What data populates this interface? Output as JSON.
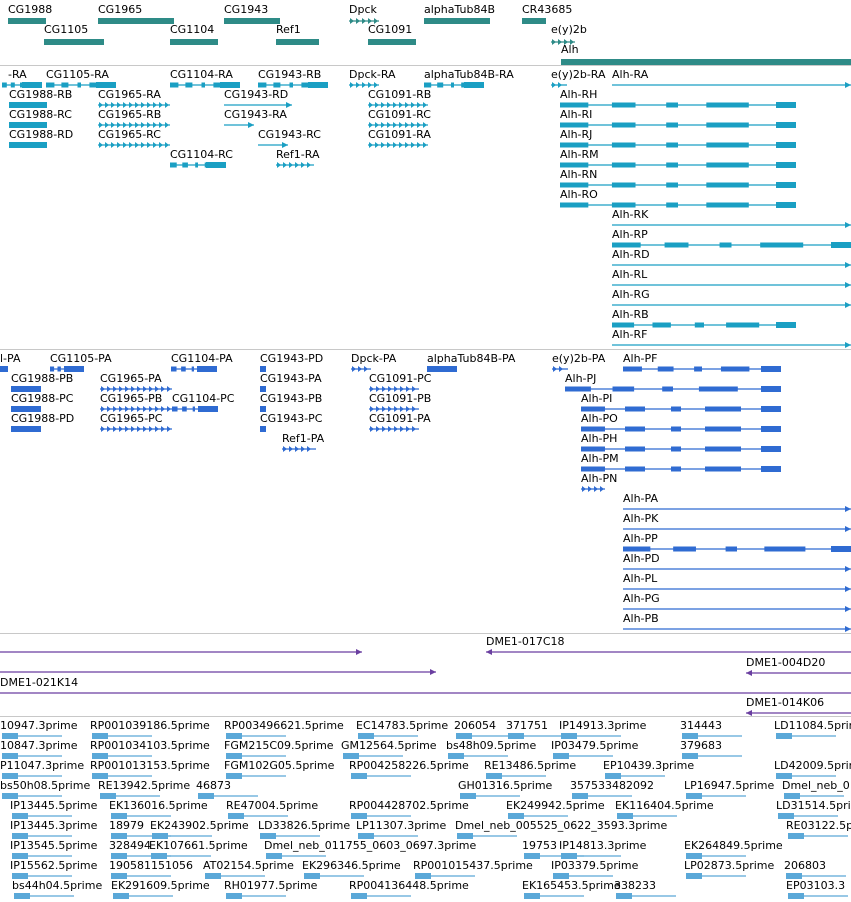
{
  "colors": {
    "gene": "#2e8b87",
    "transcript_rna": "#1a9fc3",
    "transcript_protein": "#2f6bd2",
    "clone": "#6a3fa0",
    "est": "#5aa8d8",
    "divider": "#c8c8c8"
  },
  "genes": [
    {
      "label": "CG1988"
    },
    {
      "label": "CG1965"
    },
    {
      "label": "CG1943"
    },
    {
      "label": "Dpck"
    },
    {
      "label": "alphaTub84B"
    },
    {
      "label": "CR43685"
    },
    {
      "label": "CG1105"
    },
    {
      "label": "CG1104"
    },
    {
      "label": "Ref1"
    },
    {
      "label": "CG1091"
    },
    {
      "label": "e(y)2b"
    },
    {
      "label": "Alh"
    }
  ],
  "rna": [
    {
      "label": "-RA"
    },
    {
      "label": "CG1105-RA"
    },
    {
      "label": "CG1104-RA"
    },
    {
      "label": "CG1943-RB"
    },
    {
      "label": "Dpck-RA"
    },
    {
      "label": "alphaTub84B-RA"
    },
    {
      "label": "e(y)2b-RA"
    },
    {
      "label": "Alh-RA"
    },
    {
      "label": "CG1988-RB"
    },
    {
      "label": "CG1965-RA"
    },
    {
      "label": "CG1943-RD"
    },
    {
      "label": "CG1091-RB"
    },
    {
      "label": "Alh-RH"
    },
    {
      "label": "CG1988-RC"
    },
    {
      "label": "CG1965-RB"
    },
    {
      "label": "CG1943-RA"
    },
    {
      "label": "CG1091-RC"
    },
    {
      "label": "Alh-RI"
    },
    {
      "label": "CG1988-RD"
    },
    {
      "label": "CG1965-RC"
    },
    {
      "label": "CG1943-RC"
    },
    {
      "label": "CG1091-RA"
    },
    {
      "label": "Alh-RJ"
    },
    {
      "label": "CG1104-RC"
    },
    {
      "label": "Ref1-RA"
    },
    {
      "label": "Alh-RM"
    },
    {
      "label": "Alh-RN"
    },
    {
      "label": "Alh-RO"
    },
    {
      "label": "Alh-RK"
    },
    {
      "label": "Alh-RP"
    },
    {
      "label": "Alh-RD"
    },
    {
      "label": "Alh-RL"
    },
    {
      "label": "Alh-RG"
    },
    {
      "label": "Alh-RB"
    },
    {
      "label": "Alh-RF"
    }
  ],
  "protein": [
    {
      "label": "l-PA"
    },
    {
      "label": "CG1105-PA"
    },
    {
      "label": "CG1104-PA"
    },
    {
      "label": "CG1943-PD"
    },
    {
      "label": "Dpck-PA"
    },
    {
      "label": "alphaTub84B-PA"
    },
    {
      "label": "e(y)2b-PA"
    },
    {
      "label": "Alh-PF"
    },
    {
      "label": "CG1988-PB"
    },
    {
      "label": "CG1965-PA"
    },
    {
      "label": "CG1943-PA"
    },
    {
      "label": "CG1091-PC"
    },
    {
      "label": "Alh-PJ"
    },
    {
      "label": "CG1988-PC"
    },
    {
      "label": "CG1965-PB"
    },
    {
      "label": "CG1104-PC"
    },
    {
      "label": "CG1943-PB"
    },
    {
      "label": "CG1091-PB"
    },
    {
      "label": "Alh-PI"
    },
    {
      "label": "CG1988-PD"
    },
    {
      "label": "CG1965-PC"
    },
    {
      "label": "CG1943-PC"
    },
    {
      "label": "CG1091-PA"
    },
    {
      "label": "Alh-PO"
    },
    {
      "label": "Ref1-PA"
    },
    {
      "label": "Alh-PH"
    },
    {
      "label": "Alh-PM"
    },
    {
      "label": "Alh-PN"
    },
    {
      "label": "Alh-PA"
    },
    {
      "label": "Alh-PK"
    },
    {
      "label": "Alh-PP"
    },
    {
      "label": "Alh-PD"
    },
    {
      "label": "Alh-PL"
    },
    {
      "label": "Alh-PG"
    },
    {
      "label": "Alh-PB"
    }
  ],
  "clones": [
    {
      "label": "DME1-017C18"
    },
    {
      "label": "DME1-004D20"
    },
    {
      "label": "DME1-021K14"
    },
    {
      "label": "DME1-014K06"
    }
  ],
  "ests": [
    {
      "label": "10947.3prime"
    },
    {
      "label": "RP001039186.5prime"
    },
    {
      "label": "RP003496621.5prime"
    },
    {
      "label": "EC14783.5prime"
    },
    {
      "label": "206054"
    },
    {
      "label": "371751"
    },
    {
      "label": "IP14913.3prime"
    },
    {
      "label": "314443"
    },
    {
      "label": "LD11084.5prime"
    },
    {
      "label": "10847.3prime"
    },
    {
      "label": "RP001034103.5prime"
    },
    {
      "label": "FGM215C09.5prime"
    },
    {
      "label": "GM12564.5prime"
    },
    {
      "label": "bs48h09.5prime"
    },
    {
      "label": "IP03479.5prime"
    },
    {
      "label": "379683"
    },
    {
      "label": "P11047.3prime"
    },
    {
      "label": "RP001013153.5prime"
    },
    {
      "label": "FGM102G05.5prime"
    },
    {
      "label": "RP004258226.5prime"
    },
    {
      "label": "RE13486.5prime"
    },
    {
      "label": "EP10439.3prime"
    },
    {
      "label": "LD42009.5prime"
    },
    {
      "label": "bs50h08.5prime"
    },
    {
      "label": "RE13942.5prime"
    },
    {
      "label": "46873"
    },
    {
      "label": "GH01316.5prime"
    },
    {
      "label": "357533482092"
    },
    {
      "label": "LP16947.5prime"
    },
    {
      "label": "Dmel_neb_0"
    },
    {
      "label": "IP13445.5prime"
    },
    {
      "label": "EK136016.5prime"
    },
    {
      "label": "RE47004.5prime"
    },
    {
      "label": "RP004428702.5prime"
    },
    {
      "label": "EK249942.5prime"
    },
    {
      "label": "EK116404.5prime"
    },
    {
      "label": "LD31514.5prime"
    },
    {
      "label": "IP13445.3prime"
    },
    {
      "label": "18979"
    },
    {
      "label": "EK243902.5prime"
    },
    {
      "label": "LD33826.5prime"
    },
    {
      "label": "LP11307.3prime"
    },
    {
      "label": "Dmel_neb_005525_0622_3593.3prime"
    },
    {
      "label": "RE03122.5prime"
    },
    {
      "label": "IP13545.5prime"
    },
    {
      "label": "328494"
    },
    {
      "label": "EK107661.5prime"
    },
    {
      "label": "Dmel_neb_011755_0603_0697.3prime"
    },
    {
      "label": "19753"
    },
    {
      "label": "IP14813.3prime"
    },
    {
      "label": "EK264849.5prime"
    },
    {
      "label": "IP15562.5prime"
    },
    {
      "label": "190581151056"
    },
    {
      "label": "AT02154.5prime"
    },
    {
      "label": "EK296346.5prime"
    },
    {
      "label": "RP001015437.5prime"
    },
    {
      "label": "IP03379.5prime"
    },
    {
      "label": "LP02873.5prime"
    },
    {
      "label": "206803"
    },
    {
      "label": "bs44h04.5prime"
    },
    {
      "label": "EK291609.5prime"
    },
    {
      "label": "RH01977.5prime"
    },
    {
      "label": "RP004136448.5prime"
    },
    {
      "label": "EK165453.5prime"
    },
    {
      "label": "338233"
    },
    {
      "label": "EP03103.3"
    }
  ]
}
